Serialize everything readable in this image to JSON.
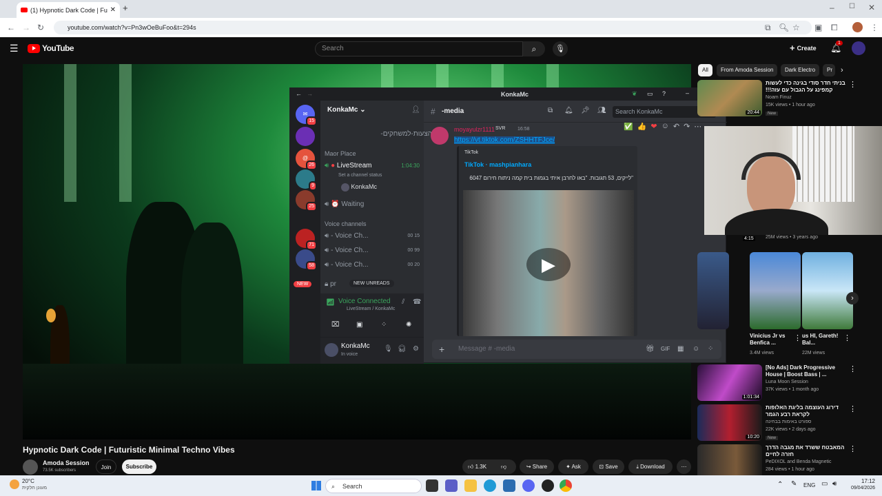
{
  "browser": {
    "tab_title": "(1) Hypnotic Dark Code | Futuri",
    "url": "youtube.com/watch?v=Pn3wOeBuFoo&t=294s"
  },
  "youtube": {
    "logo": "YouTube",
    "search_placeholder": "Search",
    "create_label": "Create",
    "notif_count": "1",
    "chips": [
      "All",
      "From Amoda Session",
      "Dark Electro",
      "Pr"
    ],
    "video_title": "Hypnotic Dark Code | Futuristic Minimal Techno Vibes",
    "channel_name": "Amoda Session",
    "subscribers": "73.5K subscribers",
    "join_label": "Join",
    "subscribe_label": "Subscribe",
    "likes": "1.3K",
    "share_label": "Share",
    "ask_label": "Ask",
    "save_label": "Save",
    "download_label": "Download",
    "sidebar": [
      {
        "title": "בניתי חדר סודי בגינה כדי לעשות קמפינג על הגבול עם עזה!!!",
        "channel": "Noam Finuz",
        "meta": "15K views • 1 hour ago",
        "badge": "New",
        "duration": "20:44"
      },
      {
        "title": "",
        "channel": "",
        "meta": "25M views • 3 years ago",
        "badge": "",
        "duration": "4:15"
      },
      {
        "title": "[No Ads] Dark Progressive House | Boost Bass | ...",
        "channel": "Luna Moon Session",
        "meta": "37K views • 1 month ago",
        "badge": "",
        "duration": "1:01:34"
      },
      {
        "title": "דירוג העוצמה בליגת האלופות לקראת רבע הגמר",
        "channel": "ספורט באימות בבחינה",
        "meta": "22K views • 2 days ago",
        "badge": "New",
        "duration": "10:20"
      },
      {
        "title": "המאבטח ששרד את מגבה הדרך חזרה לחיים",
        "channel": "PeDIXOL and Benda Magnetic",
        "meta": "284 views • 1 hour ago",
        "badge": "",
        "duration": ""
      }
    ],
    "shorts": [
      {
        "title": "Vinicius Jr vs Benfica ...",
        "views": "3.4M views"
      },
      {
        "title": "us HI, Gareth! Bal...",
        "views": "22M views"
      }
    ]
  },
  "discord": {
    "title": "KonkaMc",
    "server_name": "KonkaMc",
    "channel_name": "-media",
    "search_placeholder": "Search KonkaMc",
    "channels": {
      "top": "הצעות-למשחקים-",
      "category1": "Maor Place",
      "livestream": "LiveStream",
      "livestream_time": "1:04:30",
      "livestream_status": "Set a channel status",
      "live_user": "KonkaMc",
      "waiting": "Waiting",
      "category2": "Voice channels",
      "voice": [
        {
          "name": "- Voice Ch...",
          "a": "00",
          "b": "15"
        },
        {
          "name": "- Voice Ch...",
          "a": "00",
          "b": "99"
        },
        {
          "name": "- Voice Ch...",
          "a": "00",
          "b": "20"
        }
      ],
      "new_unreads": "NEW UNREADS",
      "private": "pr"
    },
    "guild_badges": [
      "15",
      "26",
      "9",
      "25",
      "71",
      "58"
    ],
    "guild_new": "NEW",
    "voice_connected": "Voice Connected",
    "voice_sub": "LiveStream / KonkaMc",
    "user_name": "KonkaMc",
    "user_status": "In voice",
    "message": {
      "author": "moyayulzr1111",
      "tag": "SVR",
      "time": "16:58",
      "link": "https://vt.tiktok.com/ZSHHTFJce/",
      "embed_provider": "TikTok",
      "embed_author": "TikTok · mashpianhara",
      "embed_desc": "6047 לייקים, 53 תגובות. \"באו לחרבן איתי בגמות בית קמה ניתוח חירום\""
    },
    "message_placeholder": "Message # -media"
  },
  "taskbar": {
    "temp": "20°C",
    "weather": "מעונן חלקית",
    "search": "Search",
    "lang": "ENG",
    "time": "17:12",
    "date": "09/04/2026"
  }
}
